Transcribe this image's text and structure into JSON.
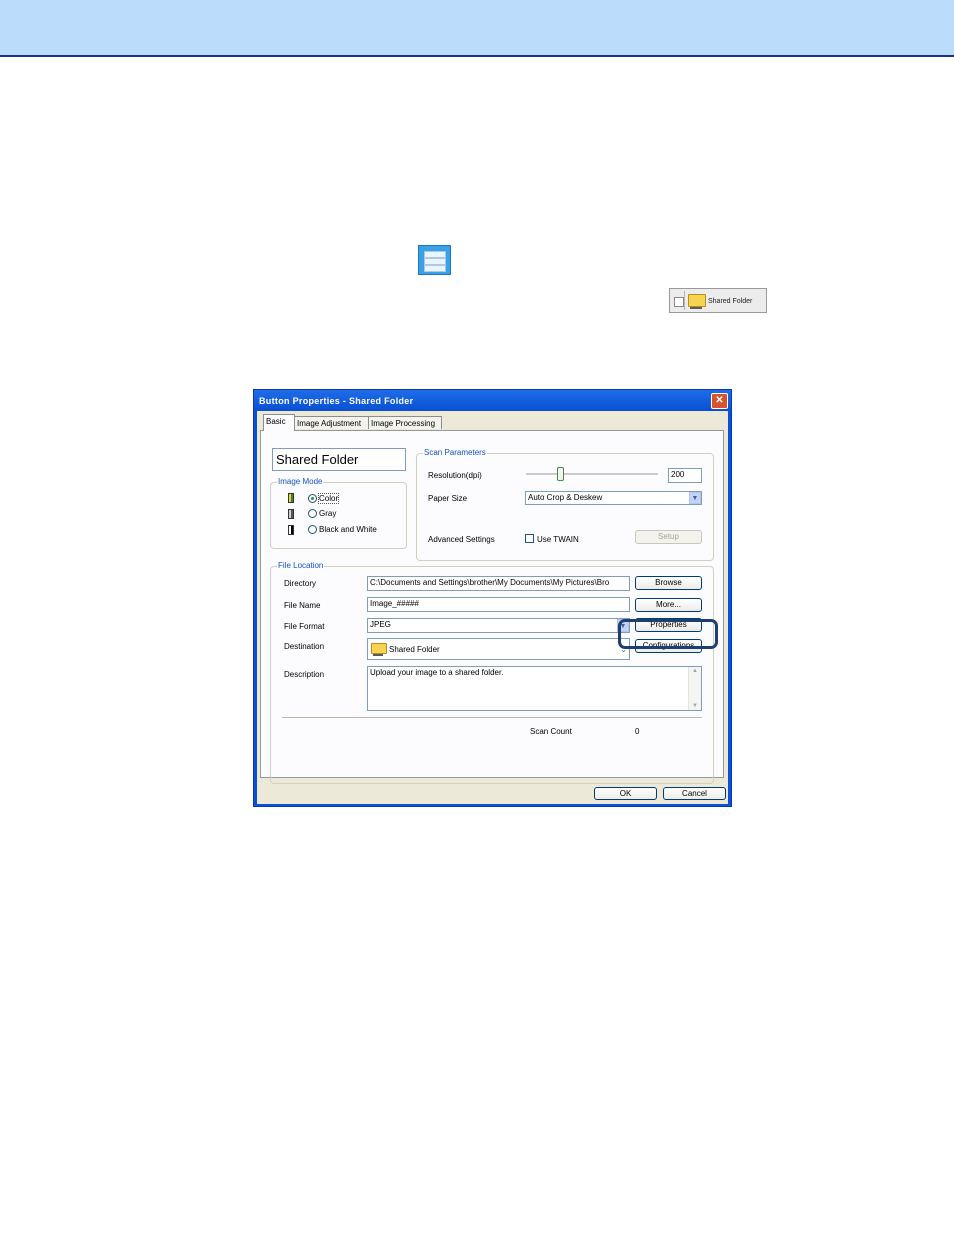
{
  "inline": {
    "chip_label": "Shared Folder"
  },
  "dialog": {
    "title": "Button Properties - Shared Folder",
    "close_glyph": "✕",
    "tabs": [
      "Basic",
      "Image Adjustment",
      "Image Processing"
    ],
    "profile_name": "Shared Folder",
    "image_mode": {
      "label": "Image Mode",
      "options": [
        "Color",
        "Gray",
        "Black and White"
      ],
      "selected": "Color"
    },
    "scan_parameters": {
      "label": "Scan Parameters",
      "resolution_label": "Resolution(dpi)",
      "resolution_value": "200",
      "resolution_slider_fraction": 0.26,
      "paper_size_label": "Paper Size",
      "paper_size_value": "Auto Crop & Deskew",
      "advanced_label": "Advanced Settings",
      "use_twain_label": "Use TWAIN",
      "use_twain_checked": false,
      "setup_label": "Setup"
    },
    "file_location": {
      "label": "File Location",
      "directory_label": "Directory",
      "directory_value": "C:\\Documents and Settings\\brother\\My Documents\\My Pictures\\Bro",
      "browse_label": "Browse",
      "file_name_label": "File Name",
      "file_name_value": "Image_#####",
      "more_label": "More...",
      "file_format_label": "File Format",
      "file_format_value": "JPEG",
      "properties_label": "Properties",
      "destination_label": "Destination",
      "destination_value": "Shared Folder",
      "configurations_label": "Configurations",
      "description_label": "Description",
      "description_value": "Upload your image to a shared folder.",
      "scan_count_label": "Scan Count",
      "scan_count_value": "0"
    },
    "ok_label": "OK",
    "cancel_label": "Cancel"
  },
  "colors": {
    "topbar": "#bcdcfb",
    "topbar_rule": "#1c2f8a",
    "titlebar": "#0a4fd4",
    "highlight": "#1e3f72"
  }
}
